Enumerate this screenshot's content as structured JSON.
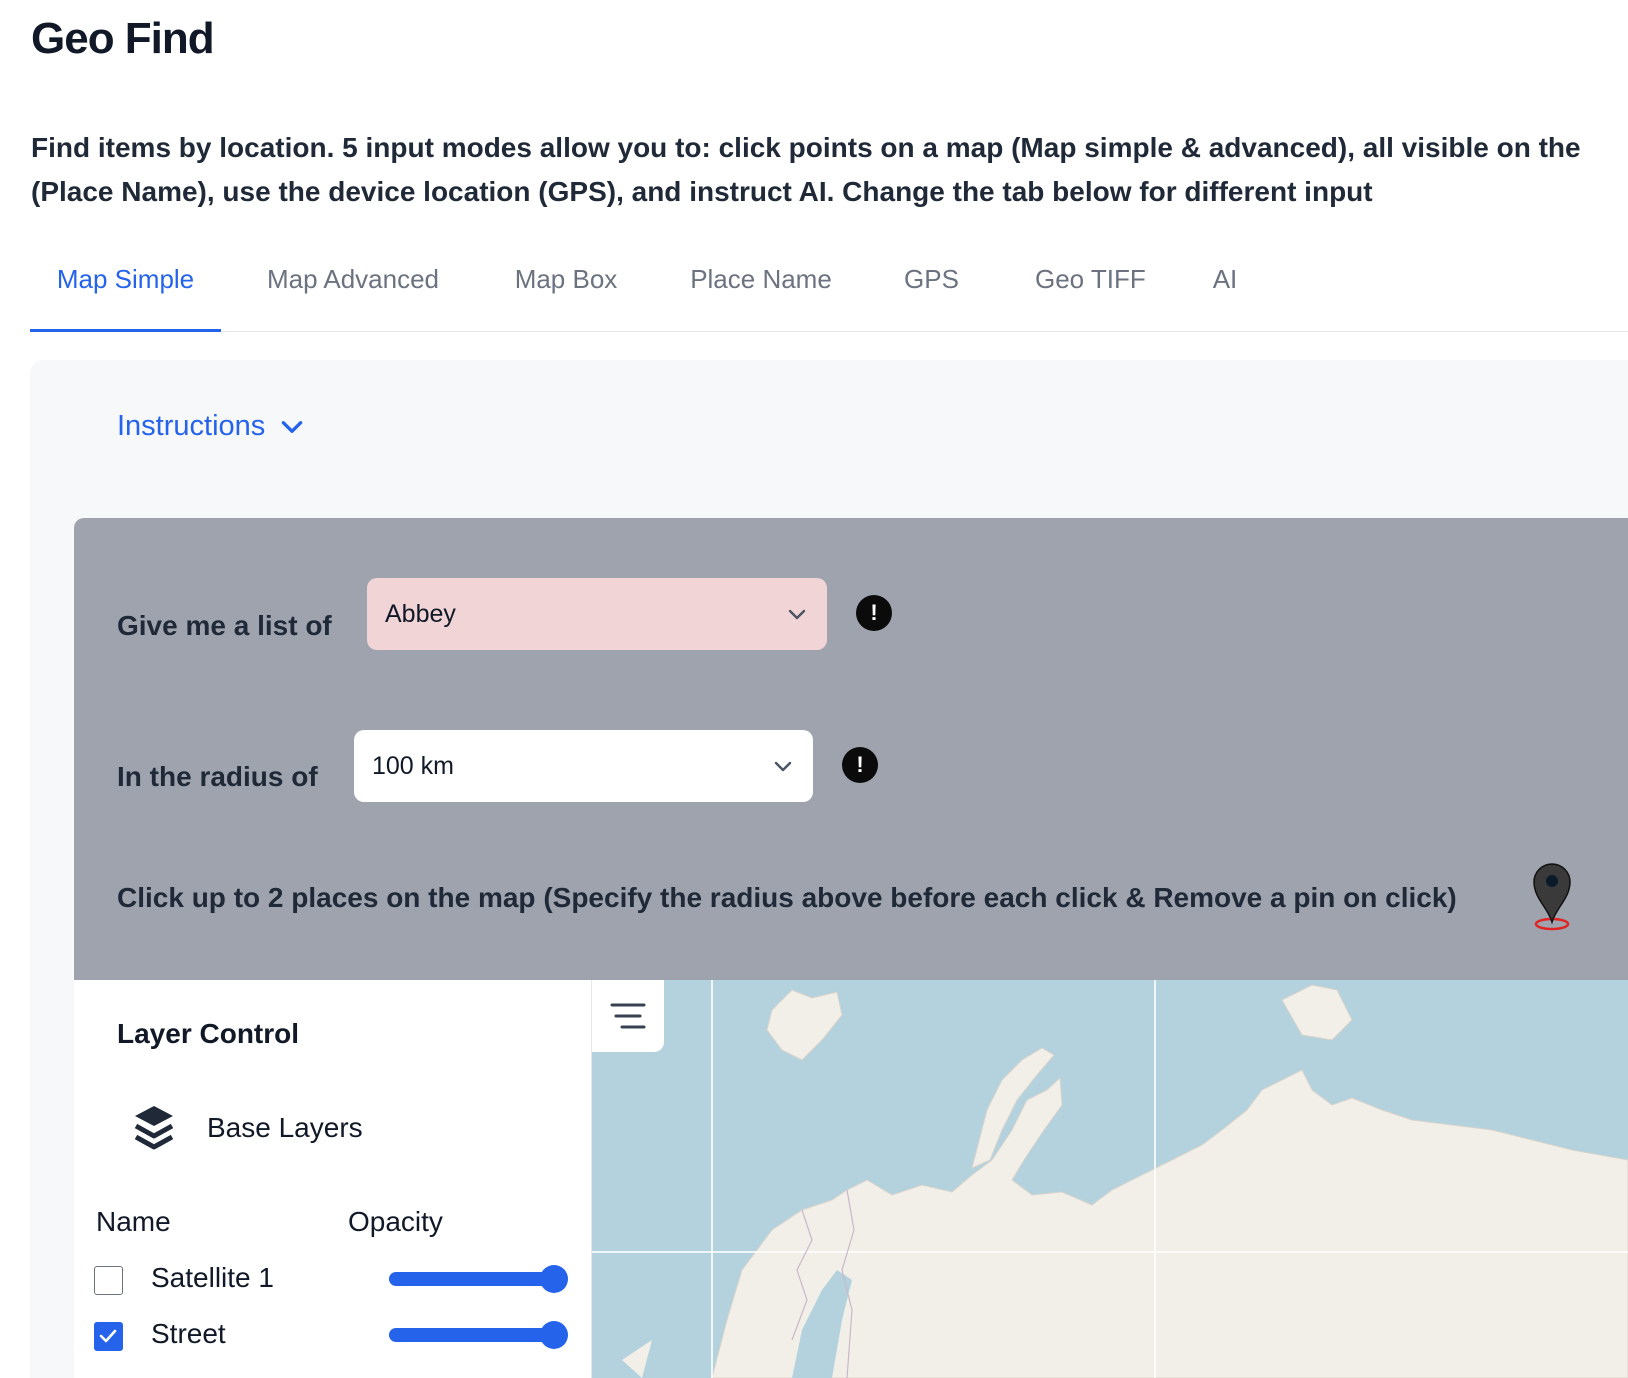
{
  "page": {
    "title": "Geo Find",
    "description_line1": "Find items by location. 5 input modes allow you to: click points on a map (Map simple & advanced), all visible on the",
    "description_line2": "(Place Name), use the device location (GPS), and instruct AI. Change the tab below for different input"
  },
  "tabs": [
    {
      "label": "Map Simple",
      "active": true
    },
    {
      "label": "Map Advanced",
      "active": false
    },
    {
      "label": "Map Box",
      "active": false
    },
    {
      "label": "Place Name",
      "active": false
    },
    {
      "label": "GPS",
      "active": false
    },
    {
      "label": "Geo TIFF",
      "active": false
    },
    {
      "label": "AI",
      "active": false
    }
  ],
  "instructions": {
    "label": "Instructions",
    "icon": "chevron-down-icon"
  },
  "form": {
    "list_label": "Give me a list of",
    "list_value": "Abbey",
    "radius_label": "In the radius of",
    "radius_value": "100 km",
    "click_hint": "Click up to 2 places on the map (Specify the radius above before each click & Remove a pin on click)",
    "info_glyph": "!"
  },
  "layer_control": {
    "title": "Layer Control",
    "base_layers_label": "Base Layers",
    "col_name": "Name",
    "col_opacity": "Opacity",
    "layers": [
      {
        "name": "Satellite 1",
        "checked": false,
        "opacity": 1.0
      },
      {
        "name": "Street",
        "checked": true,
        "opacity": 1.0
      }
    ]
  },
  "colors": {
    "accent": "#2563eb",
    "form_bg": "#9ea3ae",
    "list_select_bg": "#f1d4d6",
    "map_water": "#b3d2dd",
    "map_land": "#f2efe9"
  }
}
